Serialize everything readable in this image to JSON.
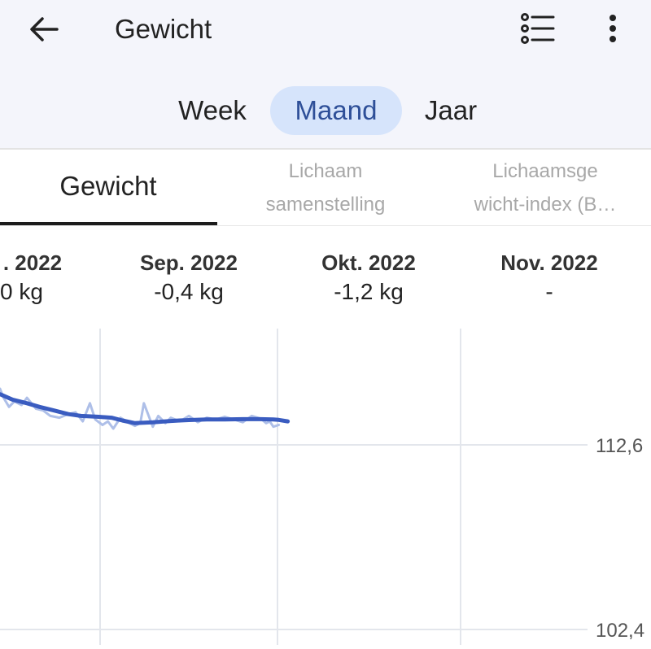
{
  "header": {
    "title": "Gewicht",
    "back_icon": "arrow-left-icon",
    "list_icon": "list-icon",
    "more_icon": "more-vertical-icon"
  },
  "period_tabs": [
    {
      "label": "Week",
      "selected": false
    },
    {
      "label": "Maand",
      "selected": true
    },
    {
      "label": "Jaar",
      "selected": false
    }
  ],
  "metric_tabs": [
    {
      "line1": "Gewicht",
      "line2": "",
      "selected": true
    },
    {
      "line1": "Lichaam",
      "line2": "samenstelling",
      "selected": false
    },
    {
      "line1": "Lichaamsge",
      "line2": "wicht-index (B…",
      "selected": false
    }
  ],
  "months": [
    {
      "label": ". 2022",
      "delta": "0 kg"
    },
    {
      "label": "Sep. 2022",
      "delta": "-0,4 kg"
    },
    {
      "label": "Okt. 2022",
      "delta": "-1,2 kg"
    },
    {
      "label": "Nov. 2022",
      "delta": "-"
    }
  ],
  "colors": {
    "accent": "#3a5cc0",
    "raw_line": "#aebfe8",
    "selected_tab_bg": "#d6e4fb",
    "selected_tab_text": "#2e4f98",
    "header_bg": "#f4f5fb"
  },
  "chart_data": {
    "type": "line",
    "y_ticks": [
      {
        "value": 112.6,
        "label": "112,6"
      },
      {
        "value": 102.4,
        "label": "102,4"
      }
    ],
    "series": [
      {
        "style": "trend",
        "x": [
          0.0,
          0.07,
          0.15,
          0.22,
          0.3,
          0.38,
          0.45,
          0.55,
          0.62,
          0.68,
          0.75,
          0.85,
          0.95,
          1.0,
          1.05,
          1.15,
          1.25,
          1.35,
          1.45,
          1.52,
          1.55,
          1.6
        ],
        "values": [
          115.4,
          115.1,
          114.9,
          114.7,
          114.5,
          114.3,
          114.2,
          114.15,
          114.1,
          113.95,
          113.8,
          113.85,
          113.92,
          113.95,
          113.97,
          114.0,
          114.0,
          114.02,
          114.02,
          114.0,
          113.98,
          113.9
        ]
      },
      {
        "style": "raw",
        "x": [
          0.0,
          0.02,
          0.05,
          0.08,
          0.12,
          0.15,
          0.2,
          0.24,
          0.28,
          0.33,
          0.38,
          0.42,
          0.46,
          0.5,
          0.53,
          0.57,
          0.6,
          0.63,
          0.67,
          0.72,
          0.75,
          0.78,
          0.8,
          0.85,
          0.88,
          0.92,
          0.95,
          1.0,
          1.05,
          1.1,
          1.15,
          1.2,
          1.25,
          1.3,
          1.35,
          1.4,
          1.45,
          1.48,
          1.5,
          1.52,
          1.55
        ],
        "values": [
          115.7,
          115.2,
          114.7,
          115.0,
          114.8,
          115.2,
          114.6,
          114.5,
          114.2,
          114.1,
          114.3,
          114.4,
          113.9,
          114.9,
          114.0,
          113.7,
          113.9,
          113.5,
          114.1,
          113.8,
          113.65,
          113.8,
          114.9,
          113.6,
          114.2,
          113.8,
          114.1,
          113.9,
          114.2,
          113.85,
          114.1,
          114.0,
          114.15,
          114.0,
          113.85,
          114.2,
          114.05,
          113.8,
          113.9,
          113.6,
          113.7
        ]
      }
    ]
  }
}
